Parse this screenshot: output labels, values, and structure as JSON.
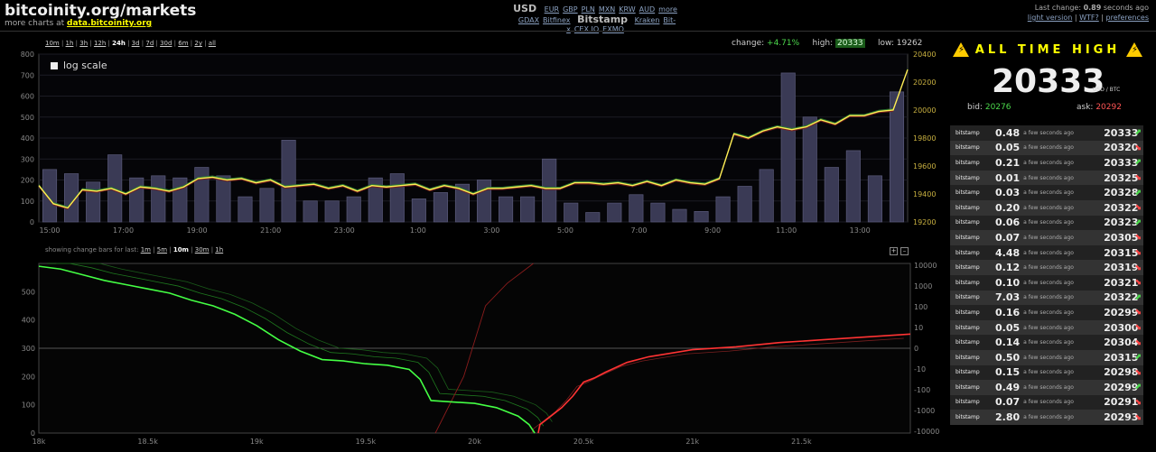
{
  "header": {
    "site_title": "bitcoinity.org/markets",
    "more_charts_prefix": "more charts at",
    "more_charts_link": "data.bitcoinity.org",
    "currency_main": "USD",
    "currencies": [
      "EUR",
      "GBP",
      "PLN",
      "MXN",
      "KRW",
      "AUD",
      "more"
    ],
    "exchanges_left": [
      "GDAX",
      "Bitfinex"
    ],
    "exchange_selected": "Bitstamp",
    "exchanges_right": [
      "Kraken",
      "Bit-x",
      "CEX.IO",
      "EXMO"
    ],
    "last_change_prefix": "Last change:",
    "last_change_value": "0.89",
    "last_change_suffix": "seconds ago",
    "links": [
      "light version",
      "WTF?",
      "preferences"
    ]
  },
  "range_bar": {
    "options": [
      "10m",
      "1h",
      "3h",
      "12h",
      "24h",
      "3d",
      "7d",
      "30d",
      "6m",
      "2y",
      "all"
    ],
    "selected": "24h"
  },
  "stats": {
    "change_label": "change:",
    "change_value": "+4.71%",
    "high_label": "high:",
    "high_value": "20333",
    "low_label": "low:",
    "low_value": "19262"
  },
  "log_scale_label": "log scale",
  "change_bars": {
    "label": "showing change bars for last:",
    "options": [
      "1m",
      "5m",
      "10m",
      "30m",
      "1h"
    ],
    "selected": "10m",
    "zoom_in": "+",
    "zoom_out": "–"
  },
  "ath": {
    "title": "ALL TIME HIGH",
    "price": "20333",
    "unit": "USD / BTC",
    "bid_label": "bid:",
    "bid_value": "20276",
    "ask_label": "ask:",
    "ask_value": "20292"
  },
  "trades": [
    {
      "ex": "bitstamp",
      "amt": "0.48",
      "age": "a few seconds ago",
      "price": "20333",
      "dir": "up"
    },
    {
      "ex": "bitstamp",
      "amt": "0.05",
      "age": "a few seconds ago",
      "price": "20320",
      "dir": "down"
    },
    {
      "ex": "bitstamp",
      "amt": "0.21",
      "age": "a few seconds ago",
      "price": "20333",
      "dir": "up"
    },
    {
      "ex": "bitstamp",
      "amt": "0.01",
      "age": "a few seconds ago",
      "price": "20325",
      "dir": "down"
    },
    {
      "ex": "bitstamp",
      "amt": "0.03",
      "age": "a few seconds ago",
      "price": "20328",
      "dir": "up"
    },
    {
      "ex": "bitstamp",
      "amt": "0.20",
      "age": "a few seconds ago",
      "price": "20322",
      "dir": "down"
    },
    {
      "ex": "bitstamp",
      "amt": "0.06",
      "age": "a few seconds ago",
      "price": "20323",
      "dir": "up"
    },
    {
      "ex": "bitstamp",
      "amt": "0.07",
      "age": "a few seconds ago",
      "price": "20305",
      "dir": "down"
    },
    {
      "ex": "bitstamp",
      "amt": "4.48",
      "age": "a few seconds ago",
      "price": "20315",
      "dir": "down"
    },
    {
      "ex": "bitstamp",
      "amt": "0.12",
      "age": "a few seconds ago",
      "price": "20319",
      "dir": "down"
    },
    {
      "ex": "bitstamp",
      "amt": "0.10",
      "age": "a few seconds ago",
      "price": "20321",
      "dir": "down"
    },
    {
      "ex": "bitstamp",
      "amt": "7.03",
      "age": "a few seconds ago",
      "price": "20322",
      "dir": "up"
    },
    {
      "ex": "bitstamp",
      "amt": "0.16",
      "age": "a few seconds ago",
      "price": "20299",
      "dir": "down"
    },
    {
      "ex": "bitstamp",
      "amt": "0.05",
      "age": "a few seconds ago",
      "price": "20300",
      "dir": "down"
    },
    {
      "ex": "bitstamp",
      "amt": "0.14",
      "age": "a few seconds ago",
      "price": "20304",
      "dir": "down"
    },
    {
      "ex": "bitstamp",
      "amt": "0.50",
      "age": "a few seconds ago",
      "price": "20315",
      "dir": "up"
    },
    {
      "ex": "bitstamp",
      "amt": "0.15",
      "age": "a few seconds ago",
      "price": "20298",
      "dir": "down"
    },
    {
      "ex": "bitstamp",
      "amt": "0.49",
      "age": "a few seconds ago",
      "price": "20299",
      "dir": "up"
    },
    {
      "ex": "bitstamp",
      "amt": "0.07",
      "age": "a few seconds ago",
      "price": "20291",
      "dir": "down"
    },
    {
      "ex": "bitstamp",
      "amt": "2.80",
      "age": "a few seconds ago",
      "price": "20293",
      "dir": "down"
    }
  ],
  "colors": {
    "price_line": "#ffee55",
    "spread_up": "#2e7d32",
    "spread_down": "#7a1f1f",
    "volume_bar": "#3a3a55",
    "bids_line": "#44ff44",
    "asks_line": "#ff3333"
  },
  "chart_data": [
    {
      "type": "line",
      "x_ticks": [
        "15:00",
        "17:00",
        "19:00",
        "21:00",
        "23:00",
        "1:00",
        "3:00",
        "5:00",
        "7:00",
        "9:00",
        "11:00",
        "13:00"
      ],
      "left_axis_ticks": [
        0,
        100,
        200,
        300,
        400,
        500,
        600,
        700,
        800
      ],
      "right_axis_ticks": [
        19200,
        19400,
        19600,
        19800,
        20000,
        20200,
        20400
      ],
      "ylim_volume": [
        0,
        800
      ],
      "ylim_price": [
        19200,
        20400
      ],
      "volume": [
        250,
        230,
        190,
        320,
        210,
        220,
        210,
        260,
        220,
        120,
        160,
        390,
        100,
        100,
        120,
        210,
        230,
        110,
        140,
        180,
        200,
        120,
        120,
        300,
        90,
        45,
        90,
        130,
        90,
        60,
        50,
        120,
        170,
        250,
        710,
        500,
        260,
        340,
        220,
        620
      ],
      "price": [
        19460,
        19330,
        19300,
        19430,
        19420,
        19440,
        19400,
        19450,
        19440,
        19420,
        19450,
        19510,
        19520,
        19500,
        19510,
        19480,
        19500,
        19450,
        19460,
        19470,
        19440,
        19460,
        19420,
        19460,
        19450,
        19460,
        19470,
        19430,
        19460,
        19440,
        19400,
        19440,
        19440,
        19450,
        19460,
        19440,
        19440,
        19480,
        19480,
        19470,
        19480,
        19460,
        19490,
        19460,
        19500,
        19480,
        19470,
        19510,
        19830,
        19800,
        19850,
        19880,
        19860,
        19880,
        19930,
        19900,
        19960,
        19960,
        19990,
        20000,
        20290
      ]
    },
    {
      "type": "line",
      "x_ticks": [
        "18k",
        "18.5k",
        "19k",
        "19.5k",
        "20k",
        "20.5k",
        "21k",
        "21.5k"
      ],
      "xlim": [
        18000,
        22000
      ],
      "left_axis_ticks": [
        0,
        100,
        200,
        300,
        400,
        500
      ],
      "right_axis_ticks": [
        "10000",
        "1000",
        "100",
        "10",
        "0",
        "-10",
        "-100",
        "-1000",
        "-10000"
      ],
      "ylim": [
        0,
        600
      ],
      "series": [
        {
          "name": "bids",
          "x": [
            18000,
            18100,
            18200,
            18300,
            18400,
            18500,
            18600,
            18700,
            18800,
            18900,
            19000,
            19100,
            19200,
            19300,
            19400,
            19500,
            19600,
            19700,
            19750,
            19800,
            19900,
            20000,
            20100,
            20200,
            20250,
            20276
          ],
          "y": [
            590,
            580,
            560,
            540,
            525,
            510,
            495,
            470,
            450,
            420,
            380,
            330,
            290,
            260,
            255,
            245,
            240,
            225,
            190,
            115,
            110,
            105,
            90,
            60,
            30,
            0
          ]
        },
        {
          "name": "asks",
          "x": [
            20292,
            20300,
            20350,
            20400,
            20450,
            20500,
            20550,
            20600,
            20700,
            20800,
            21000,
            21200,
            21400,
            21600,
            21800,
            22000
          ],
          "y": [
            0,
            30,
            60,
            90,
            130,
            180,
            195,
            215,
            250,
            270,
            295,
            305,
            320,
            330,
            340,
            350
          ]
        }
      ]
    }
  ]
}
